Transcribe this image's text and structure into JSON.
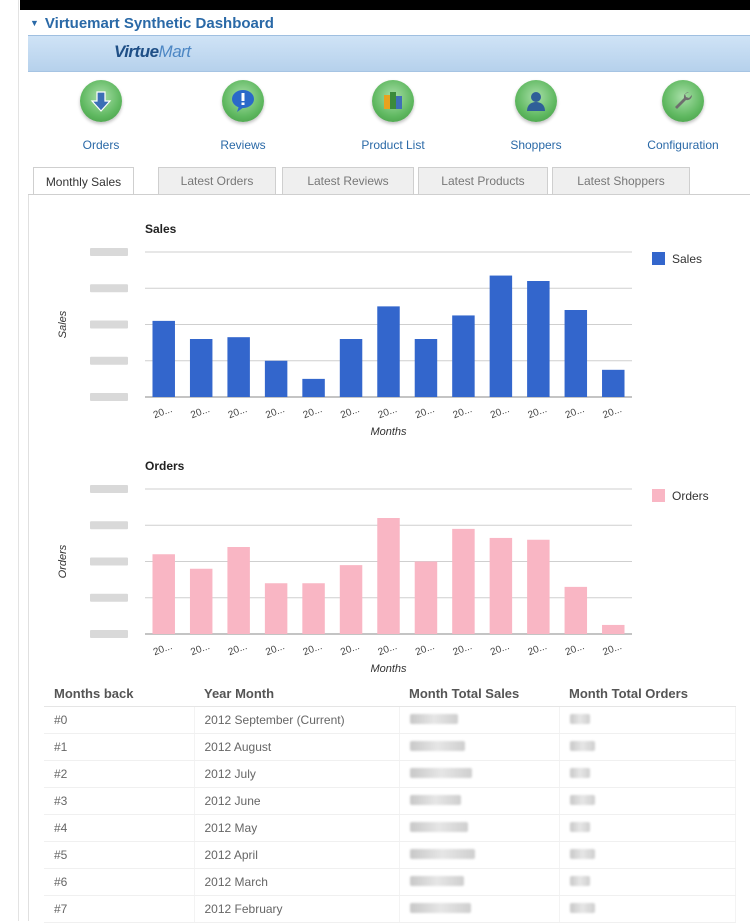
{
  "header": {
    "title": "Virtuemart Synthetic Dashboard"
  },
  "logo": {
    "part1": "Virtue",
    "part2": "Mart"
  },
  "quick_links": [
    {
      "label": "Orders",
      "icon": "orders-arrow-icon"
    },
    {
      "label": "Reviews",
      "icon": "reviews-speech-icon"
    },
    {
      "label": "Product List",
      "icon": "product-list-icon"
    },
    {
      "label": "Shoppers",
      "icon": "shoppers-user-icon"
    },
    {
      "label": "Configuration",
      "icon": "configuration-wrench-icon"
    }
  ],
  "tabs": [
    {
      "label": "Monthly Sales",
      "active": true
    },
    {
      "label": "Latest Orders",
      "active": false
    },
    {
      "label": "Latest Reviews",
      "active": false
    },
    {
      "label": "Latest Products",
      "active": false
    },
    {
      "label": "Latest Shoppers",
      "active": false
    }
  ],
  "chart_data": [
    {
      "type": "bar",
      "title": "Sales",
      "xlabel": "Months",
      "ylabel": "Sales",
      "legend": "right",
      "grid": true,
      "ylim": [
        0,
        8
      ],
      "categories": [
        "20...",
        "20...",
        "20...",
        "20...",
        "20...",
        "20...",
        "20...",
        "20...",
        "20...",
        "20...",
        "20...",
        "20..."
      ],
      "series": [
        {
          "name": "Sales",
          "color": "#3366cc",
          "values": [
            4.2,
            3.2,
            3.3,
            2.0,
            1.0,
            3.2,
            5.0,
            3.2,
            4.5,
            6.7,
            6.4,
            4.8,
            1.5
          ]
        }
      ]
    },
    {
      "type": "bar",
      "title": "Orders",
      "xlabel": "Months",
      "ylabel": "Orders",
      "legend": "right",
      "grid": true,
      "ylim": [
        0,
        8
      ],
      "categories": [
        "20...",
        "20...",
        "20...",
        "20...",
        "20...",
        "20...",
        "20...",
        "20...",
        "20...",
        "20...",
        "20...",
        "20..."
      ],
      "series": [
        {
          "name": "Orders",
          "color": "#f9b6c4",
          "values": [
            4.4,
            3.6,
            4.8,
            2.8,
            2.8,
            3.8,
            6.4,
            4.0,
            5.8,
            5.3,
            5.2,
            2.6,
            0.5
          ]
        }
      ]
    }
  ],
  "table": {
    "headers": [
      "Months back",
      "Year Month",
      "Month Total Sales",
      "Month Total Orders"
    ],
    "rows": [
      [
        "#0",
        "2012 September (Current)"
      ],
      [
        "#1",
        "2012 August"
      ],
      [
        "#2",
        "2012 July"
      ],
      [
        "#3",
        "2012 June"
      ],
      [
        "#4",
        "2012 May"
      ],
      [
        "#5",
        "2012 April"
      ],
      [
        "#6",
        "2012 March"
      ],
      [
        "#7",
        "2012 February"
      ]
    ]
  }
}
